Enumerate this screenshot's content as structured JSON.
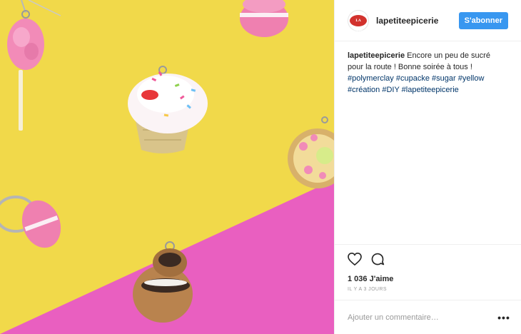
{
  "post": {
    "photo": {
      "subject": "polymer clay dessert charms on yellow and pink background",
      "colors": {
        "yellow": "#f1d94a",
        "pink": "#e95fc0"
      }
    },
    "header": {
      "avatar_text": "LA PETITE ÉPICERIE",
      "username": "lapetiteepicerie",
      "follow_label": "S'abonner",
      "follow_color": "#3897f0"
    },
    "caption": {
      "username": "lapetiteepicerie",
      "text": "Encore un peu de sucré pour la route ! Bonne soirée à tous !",
      "hashtags": [
        "#polymerclay",
        "#cupacke",
        "#sugar",
        "#yellow",
        "#création",
        "#DIY",
        "#lapetiteepicerie"
      ]
    },
    "actions": {
      "like_icon": "heart-icon",
      "comment_icon": "comment-icon"
    },
    "likes_text": "1 036 J'aime",
    "timestamp": "IL Y A 3 JOURS",
    "comment": {
      "placeholder": "Ajouter un commentaire…",
      "more_label": "•••"
    }
  }
}
